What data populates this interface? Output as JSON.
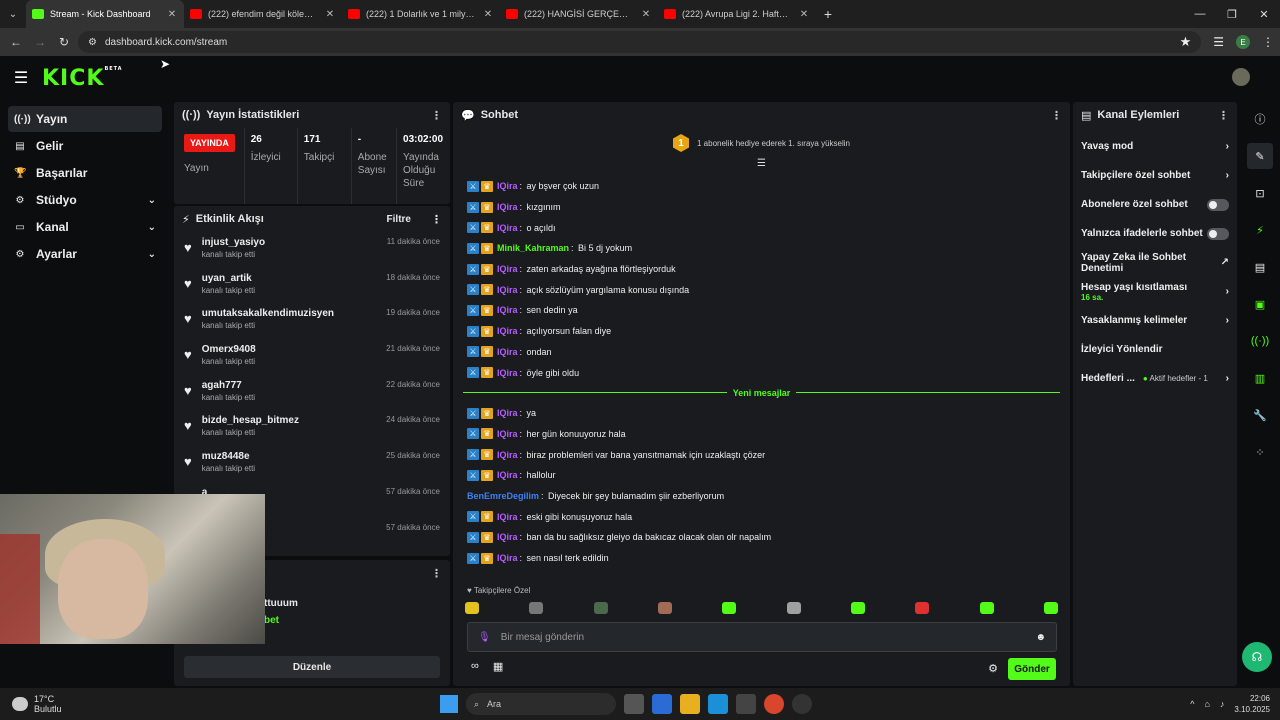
{
  "browser": {
    "tabs": [
      {
        "title": "Stream - Kick Dashboard",
        "color": "#53fc18"
      },
      {
        "title": "(222) efendim değil kölenim - Y",
        "color": "#ff0000"
      },
      {
        "title": "(222) 1 Dolarlık ve 1 milyon do",
        "color": "#ff0000"
      },
      {
        "title": "(222) HANGİSİ GERÇEK GURBE",
        "color": "#ff0000"
      },
      {
        "title": "(222) Avrupa Ligi 2. Hafta | Ron",
        "color": "#ff0000"
      }
    ],
    "url": "dashboard.kick.com/stream",
    "profile_initial": "E"
  },
  "logo": {
    "text": "KICK",
    "beta": "BETA"
  },
  "nav": [
    {
      "label": "Yayın",
      "icon": "broadcast-icon",
      "active": true
    },
    {
      "label": "Gelir",
      "icon": "wallet-icon"
    },
    {
      "label": "Başarılar",
      "icon": "trophy-icon"
    },
    {
      "label": "Stüdyo",
      "icon": "studio-icon",
      "expand": true
    },
    {
      "label": "Kanal",
      "icon": "channel-icon",
      "expand": true
    },
    {
      "label": "Ayarlar",
      "icon": "gear-icon",
      "expand": true
    }
  ],
  "stats_panel": {
    "title": "Yayın İstatistikleri",
    "live_badge": "YAYINDA",
    "live_label": "Yayın",
    "items": [
      {
        "value": "26",
        "label": "İzleyici"
      },
      {
        "value": "171",
        "label": "Takipçi"
      },
      {
        "value": "-",
        "label": "Abone Sayısı"
      },
      {
        "value": "03:02:00",
        "label": "Yayında Olduğu Süre"
      }
    ]
  },
  "activity": {
    "title": "Etkinlik Akışı",
    "filter": "Filtre",
    "items": [
      {
        "name": "injust_yasiyo",
        "sub": "kanalı takip etti",
        "time": "11 dakika önce"
      },
      {
        "name": "uyan_artik",
        "sub": "kanalı takip etti",
        "time": "18 dakika önce"
      },
      {
        "name": "umutaksakalkendimuzisyen",
        "sub": "kanalı takip etti",
        "time": "19 dakika önce"
      },
      {
        "name": "Omerx9408",
        "sub": "kanalı takip etti",
        "time": "21 dakika önce"
      },
      {
        "name": "agah777",
        "sub": "kanalı takip etti",
        "time": "22 dakika önce"
      },
      {
        "name": "bizde_hesap_bitmez",
        "sub": "kanalı takip etti",
        "time": "24 dakika önce"
      },
      {
        "name": "muz8448e",
        "sub": "kanalı takip etti",
        "time": "25 dakika önce"
      },
      {
        "name": "a",
        "sub": "",
        "time": "57 dakika önce"
      },
      {
        "name": "",
        "sub": "",
        "time": "57 dakika önce"
      }
    ]
  },
  "bottom_panel": {
    "name_fragment": "ttuuum",
    "sub_fragment": "bet",
    "edit_button": "Düzenle"
  },
  "chat": {
    "title": "Sohbet",
    "goal_number": "1",
    "goal_text": "1 abonelik hediye ederek 1. sıraya yükselin",
    "messages_before": [
      {
        "user": "IQira",
        "text": "ay bşver çok uzun"
      },
      {
        "user": "IQira",
        "text": "kızgınım"
      },
      {
        "user": "IQira",
        "text": "o açıldı"
      },
      {
        "user": "Minik_Kahraman",
        "text": "Bi 5 dj yokum",
        "color": "green"
      },
      {
        "user": "IQira",
        "text": "zaten arkadaş ayağına flörtleşiyorduk"
      },
      {
        "user": "IQira",
        "text": "açık sözlüyüm yargılama konusu dışında"
      },
      {
        "user": "IQira",
        "text": "sen dedin ya"
      },
      {
        "user": "IQira",
        "text": "açılıyorsun falan diye"
      },
      {
        "user": "IQira",
        "text": "ondan"
      },
      {
        "user": "IQira",
        "text": "öyle gibi oldu"
      }
    ],
    "new_messages_label": "Yeni mesajlar",
    "messages_after": [
      {
        "user": "IQira",
        "text": "ya"
      },
      {
        "user": "IQira",
        "text": "her gün konuuyoruz hala"
      },
      {
        "user": "IQira",
        "text": "biraz problemleri var bana yansıtmamak için uzaklaştı çözer"
      },
      {
        "user": "IQira",
        "text": "hallolur"
      },
      {
        "user": "BenEmreDegilim",
        "text": "Diyecek bir şey bulamadım şiir ezberliyorum",
        "color": "blue"
      },
      {
        "user": "IQira",
        "text": "eski gibi konuşuyoruz hala"
      },
      {
        "user": "IQira",
        "text": "ban da bu sağlıksız gleiyo da bakıcaz olacak olan olr napalım"
      },
      {
        "user": "IQira",
        "text": "sen nasıl terk edildin"
      }
    ],
    "followers_only": "Takipçilere Özel",
    "input_placeholder": "Bir mesaj gönderin",
    "send_label": "Gönder"
  },
  "channel_actions": {
    "title": "Kanal Eylemleri",
    "items": [
      {
        "label": "Yavaş mod",
        "kind": "chevron"
      },
      {
        "label": "Takipçilere özel sohbet",
        "kind": "chevron"
      },
      {
        "label": "Abonelere özel sohbet",
        "kind": "toggle"
      },
      {
        "label": "Yalnızca ifadelerle sohbet",
        "kind": "toggle"
      },
      {
        "label": "Yapay Zeka ile Sohbet Denetimi",
        "kind": "external"
      },
      {
        "label": "Hesap yaşı kısıtlaması",
        "sub": "16 sa.",
        "kind": "chevron"
      },
      {
        "label": "Yasaklanmış kelimeler",
        "kind": "chevron"
      },
      {
        "label": "İzleyici Yönlendir",
        "kind": "none"
      },
      {
        "label": "Hedefleri ...",
        "sub": "Aktif hedefler - 1",
        "kind": "chevron"
      }
    ]
  },
  "taskbar": {
    "temp": "17°C",
    "weather": "Bulutlu",
    "search": "Ara",
    "time": "22:06",
    "date": "3.10.2025"
  },
  "colors": {
    "accent": "#53fc18",
    "live": "#e91916",
    "purple_user": "#b65cff"
  }
}
